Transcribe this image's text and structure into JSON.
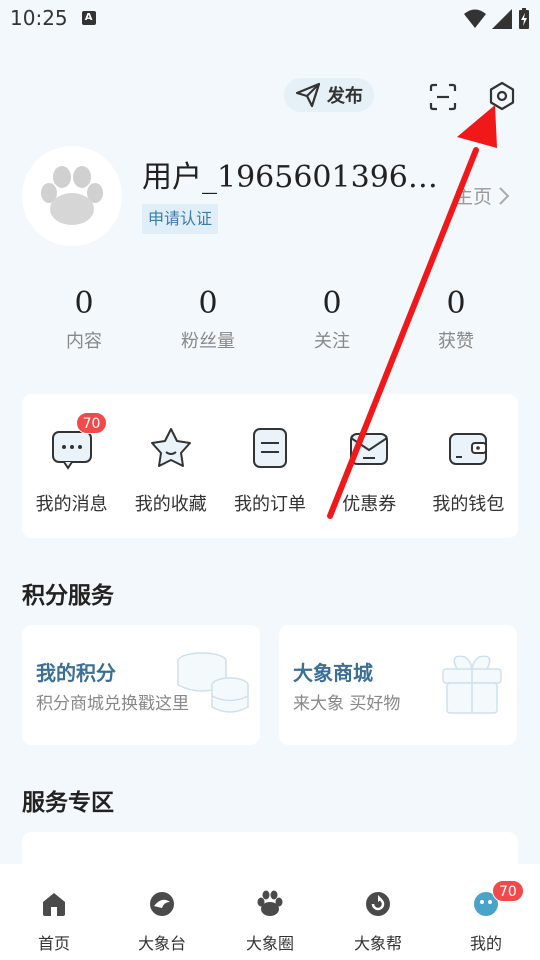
{
  "status_bar": {
    "time": "10:25",
    "app_icon_letter": "A"
  },
  "header": {
    "publish_label": "发布"
  },
  "profile": {
    "username": "用户_1965601396…",
    "verify_label": "申请认证",
    "homepage_label": "主页"
  },
  "stats": [
    {
      "value": "0",
      "label": "内容"
    },
    {
      "value": "0",
      "label": "粉丝量"
    },
    {
      "value": "0",
      "label": "关注"
    },
    {
      "value": "0",
      "label": "获赞"
    }
  ],
  "quick_links": [
    {
      "label": "我的消息",
      "badge": "70",
      "icon": "message-icon"
    },
    {
      "label": "我的收藏",
      "icon": "star-icon"
    },
    {
      "label": "我的订单",
      "icon": "order-icon"
    },
    {
      "label": "优惠券",
      "icon": "coupon-icon"
    },
    {
      "label": "我的钱包",
      "icon": "wallet-icon"
    }
  ],
  "points_section": {
    "title": "积分服务",
    "cards": [
      {
        "title": "我的积分",
        "subtitle": "积分商城兑换戳这里",
        "icon": "coins-icon"
      },
      {
        "title": "大象商城",
        "subtitle": "来大象  买好物",
        "icon": "gift-box-icon"
      }
    ]
  },
  "service_section": {
    "title": "服务专区"
  },
  "tab_bar": [
    {
      "label": "首页",
      "icon": "home-icon"
    },
    {
      "label": "大象台",
      "icon": "elephant-tv-icon"
    },
    {
      "label": "大象圈",
      "icon": "paw-icon"
    },
    {
      "label": "大象帮",
      "icon": "help-icon"
    },
    {
      "label": "我的",
      "icon": "me-icon",
      "badge": "70"
    }
  ],
  "colors": {
    "accent": "#3c6f96",
    "badge": "#f24a4a",
    "background": "#f3f8fc",
    "arrow": "#f01818"
  }
}
